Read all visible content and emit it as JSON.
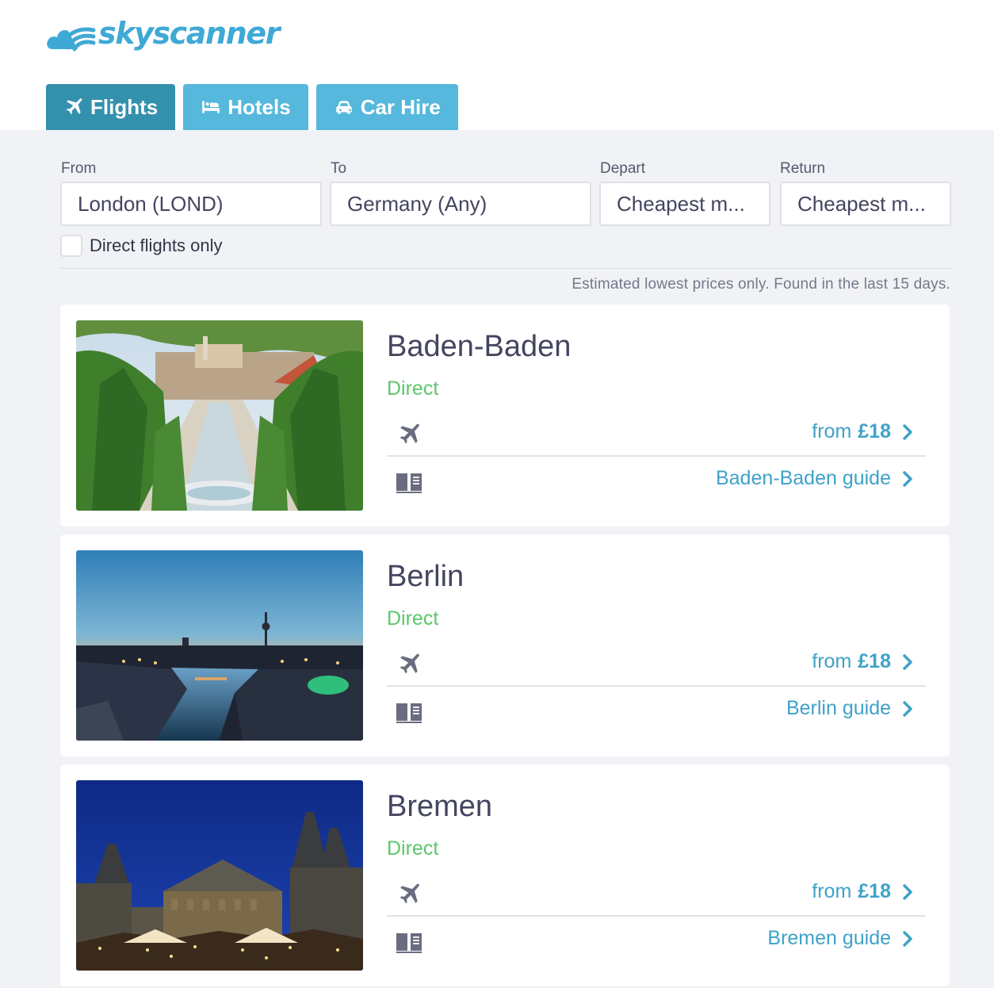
{
  "brand": {
    "name": "skyscanner"
  },
  "tabs": [
    {
      "label": "Flights",
      "icon": "plane-icon",
      "active": true
    },
    {
      "label": "Hotels",
      "icon": "bed-icon",
      "active": false
    },
    {
      "label": "Car Hire",
      "icon": "car-icon",
      "active": false
    }
  ],
  "search": {
    "from": {
      "label": "From",
      "value": "London (LOND)"
    },
    "to": {
      "label": "To",
      "value": "Germany (Any)"
    },
    "depart": {
      "label": "Depart",
      "value": "Cheapest m..."
    },
    "return": {
      "label": "Return",
      "value": "Cheapest m..."
    },
    "direct_only": {
      "label": "Direct flights only",
      "checked": false
    }
  },
  "note": "Estimated lowest prices only. Found in the last 15 days.",
  "results": [
    {
      "city": "Baden-Baden",
      "stops": "Direct",
      "price_prefix": "from",
      "price": "£18",
      "guide": "Baden-Baden guide"
    },
    {
      "city": "Berlin",
      "stops": "Direct",
      "price_prefix": "from",
      "price": "£18",
      "guide": "Berlin guide"
    },
    {
      "city": "Bremen",
      "stops": "Direct",
      "price_prefix": "from",
      "price": "£18",
      "guide": "Bremen guide"
    }
  ],
  "colors": {
    "brand_blue": "#3fa9d6",
    "tab_active": "#3391ad",
    "tab_inactive": "#55b8dc",
    "direct_green": "#5dc66c",
    "link_blue": "#3fa2c8"
  }
}
